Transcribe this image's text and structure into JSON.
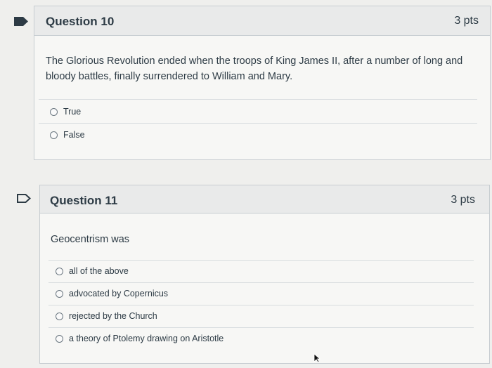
{
  "q10": {
    "title": "Question 10",
    "points": "3 pts",
    "text": "The Glorious Revolution ended when the troops of King James II, after a number of long and bloody battles, finally surrendered to William and Mary.",
    "answers": [
      "True",
      "False"
    ]
  },
  "q11": {
    "title": "Question 11",
    "points": "3 pts",
    "text": "Geocentrism was",
    "answers": [
      "all of the above",
      "advocated by Copernicus",
      "rejected by the Church",
      "a theory of Ptolemy drawing on Aristotle"
    ]
  },
  "colors": {
    "flag_filled": "#2d3b45",
    "card_header": "#e9eaea",
    "border": "#c7cdd1"
  }
}
